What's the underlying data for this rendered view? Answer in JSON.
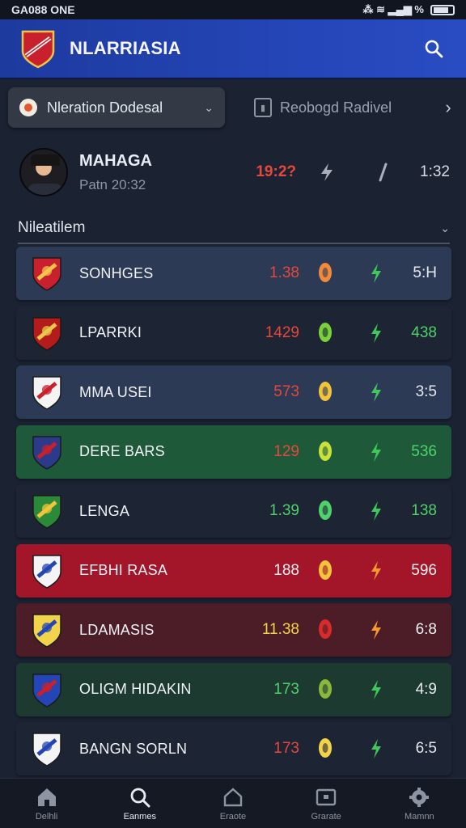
{
  "status_bar": {
    "left": "GA088 ONE",
    "right": "⁂ ≋ ▂▄▆ % "
  },
  "header": {
    "title": "NLARRIASIA"
  },
  "filter": {
    "dropdown_label": "Nleration Dodesal",
    "secondary_tab": "Reobogd Radivel"
  },
  "featured": {
    "name": "MAHAGA",
    "time": "Patn 20:32",
    "score": "19:2?",
    "value": "1:32"
  },
  "section": {
    "title": "Nileatilem"
  },
  "rows": [
    {
      "name": "SONHGES",
      "score": "1.38",
      "value": "5:H"
    },
    {
      "name": "LPARRKI",
      "score": "1429",
      "value": "438"
    },
    {
      "name": "MMA USEI",
      "score": "573",
      "value": "3:5"
    },
    {
      "name": "DERE BARS",
      "score": "129",
      "value": "536"
    },
    {
      "name": "LENGA",
      "score": "1.39",
      "value": "138"
    },
    {
      "name": "EFBHI RASA",
      "score": "188",
      "value": "596"
    },
    {
      "name": "LDAMASIS",
      "score": "11.38",
      "value": "6:8"
    },
    {
      "name": "OLIGM HIDAKIN",
      "score": "173",
      "value": "4:9"
    },
    {
      "name": "BANGN SORLN",
      "score": "173",
      "value": "6:5"
    }
  ],
  "nav": [
    {
      "label": "Delhli",
      "icon": "home-icon"
    },
    {
      "label": "Eanmes",
      "icon": "search-icon"
    },
    {
      "label": "Eraote",
      "icon": "house-outline-icon"
    },
    {
      "label": "Grarate",
      "icon": "card-icon"
    },
    {
      "label": "Mamnn",
      "icon": "settings-icon"
    }
  ],
  "colors": {
    "accent": "#2445b6",
    "row_default": "#1d2433",
    "row_blue": "#2c3a55",
    "row_green": "#1e5a3a",
    "row_red": "#a3162a",
    "row_maroon": "#4c1d26",
    "row_dark_green": "#1d3a30",
    "score_red": "#e5483b",
    "score_green": "#4fd16b",
    "score_yellow": "#f2d44a",
    "score_white": "#f4f4f4",
    "arrow_green": "#3ec95a",
    "arrow_orange": "#f29a2e"
  }
}
